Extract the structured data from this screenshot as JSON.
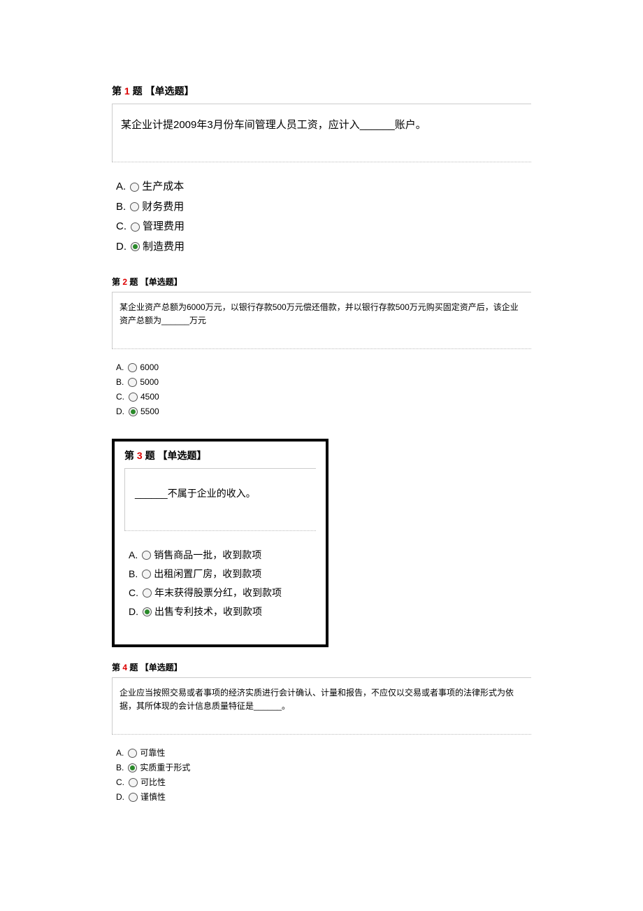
{
  "questions": [
    {
      "header_prefix": "第 ",
      "number": "1",
      "header_suffix": " 题 【单选题】",
      "prompt": "某企业计提2009年3月份车间管理人员工资，应计入______账户。",
      "options": [
        {
          "letter": "A.",
          "text": "生产成本",
          "selected": false
        },
        {
          "letter": "B.",
          "text": "财务费用",
          "selected": false
        },
        {
          "letter": "C.",
          "text": "管理费用",
          "selected": false
        },
        {
          "letter": "D.",
          "text": "制造费用",
          "selected": true
        }
      ],
      "size": "large"
    },
    {
      "header_prefix": "第 ",
      "number": "2",
      "header_suffix": " 题 【单选题】",
      "prompt": "某企业资产总额为6000万元，以银行存款500万元偿还借款，并以银行存款500万元购买固定资产后，该企业资产总额为______万元",
      "options": [
        {
          "letter": "A.",
          "text": "6000",
          "selected": false
        },
        {
          "letter": "B.",
          "text": "5000",
          "selected": false
        },
        {
          "letter": "C.",
          "text": "4500",
          "selected": false
        },
        {
          "letter": "D.",
          "text": "5500",
          "selected": true
        }
      ],
      "size": "small"
    },
    {
      "header_prefix": "第 ",
      "number": "3",
      "header_suffix": " 题 【单选题】",
      "prompt": "______不属于企业的收入。",
      "options": [
        {
          "letter": "A.",
          "text": "销售商品一批，收到款项",
          "selected": false
        },
        {
          "letter": "B.",
          "text": "出租闲置厂房，收到款项",
          "selected": false
        },
        {
          "letter": "C.",
          "text": "年末获得股票分红，收到款项",
          "selected": false
        },
        {
          "letter": "D.",
          "text": "出售专利技术，收到款项",
          "selected": true
        }
      ],
      "size": "boxed"
    },
    {
      "header_prefix": "第 ",
      "number": "4",
      "header_suffix": " 题 【单选题】",
      "prompt": "企业应当按照交易或者事项的经济实质进行会计确认、计量和报告，不应仅以交易或者事项的法律形式为依据，其所体现的会计信息质量特征是______。",
      "options": [
        {
          "letter": "A.",
          "text": "可靠性",
          "selected": false
        },
        {
          "letter": "B.",
          "text": "实质重于形式",
          "selected": true
        },
        {
          "letter": "C.",
          "text": "可比性",
          "selected": false
        },
        {
          "letter": "D.",
          "text": "谨慎性",
          "selected": false
        }
      ],
      "size": "small"
    }
  ]
}
